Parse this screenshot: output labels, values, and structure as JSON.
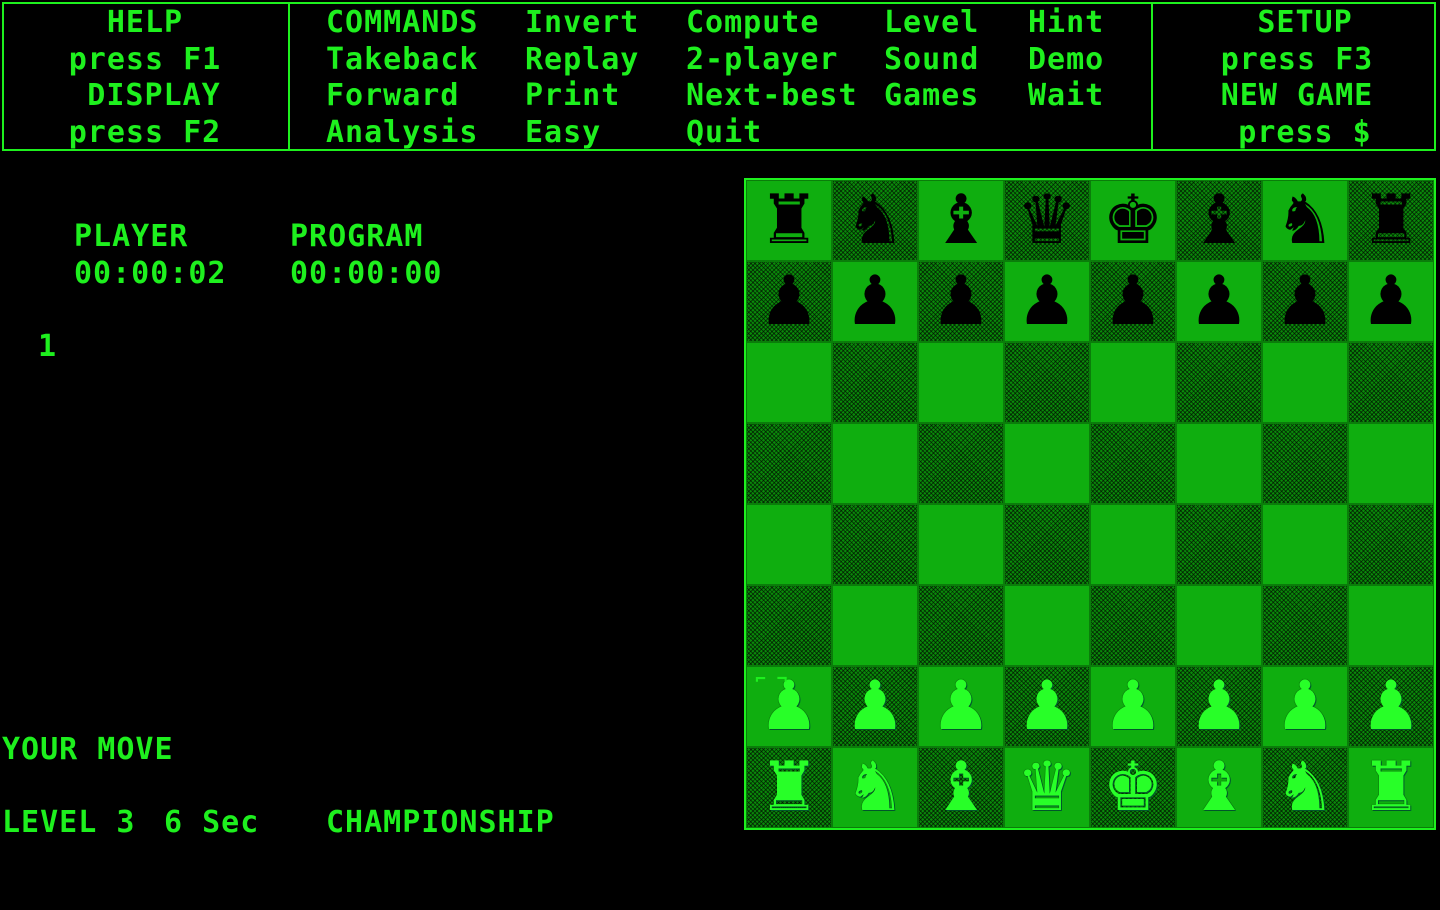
{
  "header": {
    "help_title": "HELP",
    "help_key": "press F1",
    "display_title": "DISPLAY",
    "display_key": "press F2",
    "commands": [
      [
        "COMMANDS",
        "Invert",
        "Compute",
        "Level",
        "Hint"
      ],
      [
        "Takeback",
        "Replay",
        "2-player",
        "Sound",
        "Demo"
      ],
      [
        "Forward",
        "Print",
        "Next-best",
        "Games",
        "Wait"
      ],
      [
        "Analysis",
        "Easy",
        "Quit",
        "",
        ""
      ]
    ],
    "setup_title": "SETUP",
    "setup_key": "press F3",
    "newgame_title": "NEW GAME",
    "newgame_key": "press $"
  },
  "clocks": {
    "player_label": "PLAYER",
    "player_time": "00:00:02",
    "program_label": "PROGRAM",
    "program_time": "00:00:00"
  },
  "move_list": {
    "move_number": "1"
  },
  "status": {
    "prompt": "YOUR MOVE",
    "level": "LEVEL 3",
    "time": "6 Sec",
    "mode": "CHAMPIONSHIP"
  },
  "board": {
    "ranks": [
      [
        "r",
        "n",
        "b",
        "q",
        "k",
        "b",
        "n",
        "r"
      ],
      [
        "p",
        "p",
        "p",
        "p",
        "p",
        "p",
        "p",
        "p"
      ],
      [
        "",
        "",
        "",
        "",
        "",
        "",
        "",
        ""
      ],
      [
        "",
        "",
        "",
        "",
        "",
        "",
        "",
        ""
      ],
      [
        "",
        "",
        "",
        "",
        "",
        "",
        "",
        ""
      ],
      [
        "",
        "",
        "",
        "",
        "",
        "",
        "",
        ""
      ],
      [
        "P",
        "P",
        "P",
        "P",
        "P",
        "P",
        "P",
        "P"
      ],
      [
        "R",
        "N",
        "B",
        "Q",
        "K",
        "B",
        "N",
        "R"
      ]
    ],
    "cursor_square": "a2",
    "colors": {
      "text": "#1ef01e",
      "light_square": "#0fae0f",
      "dark_square": "#0a8a0a",
      "background": "#000000"
    }
  }
}
